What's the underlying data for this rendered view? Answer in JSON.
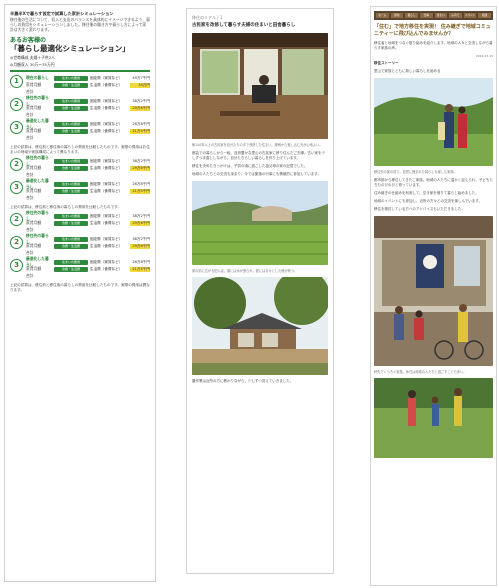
{
  "panel1": {
    "header": "半農半Xで暮らす仮定で試算した家計シミュレーション",
    "lead": "移住後の生活について、収入と支出のバランスを具体的にイメージできるよう、暮らしの費用をシミュレーションしました。移住後の働き方や暮らし方によって家計は大きく変わります。",
    "sim_title": "あるお客様の",
    "sim_title_big": "「暮らし最適化シミュレーション」",
    "meta1": "◎世帯構成 夫婦＋子供2人",
    "meta2": "◎月額収入 30万〜35万円",
    "steps": [
      {
        "num": "1",
        "head": "現在の暮らし",
        "b1": "住まいの費用",
        "b2": "食費・生活費",
        "sub1": "家賃月額",
        "sub2": "合計",
        "v1": "固定費（家賃など）",
        "v2": "生活費（食費など）",
        "a1": "49万7千円",
        "a2": "34万円"
      },
      {
        "num": "2",
        "head": "移住先の暮らし",
        "b1": "住まいの費用",
        "b2": "食費・生活費",
        "sub1": "家賃月額",
        "sub2": "合計",
        "v1": "固定費（家賃など）",
        "v2": "生活費（食費など）",
        "a1": "38万2千円",
        "a2": "29万6千円"
      },
      {
        "num": "3",
        "head": "最適化した暮らし",
        "b1": "住まいの費用",
        "b2": "食費・生活費",
        "sub1": "家賃月額",
        "sub2": "合計",
        "v1": "固定費（家賃など）",
        "v2": "生活費（食費など）",
        "a1": "26万8千円",
        "a2": "21万5千円"
      }
    ],
    "note": "上記の試算は、移住前と移住後の暮らしの費用を比較したものです。実際の費用はお住まいの地域や家族構成によって異なります。",
    "steps_b": [
      {
        "num": "2",
        "head": "移住先の暮らし",
        "b1": "住まいの費用",
        "b2": "食費・生活費",
        "sub1": "家賃月額",
        "sub2": "合計",
        "v1": "固定費（家賃など）",
        "v2": "生活費（食費など）",
        "a1": "38万2千円",
        "a2": "29万6千円"
      },
      {
        "num": "3",
        "head": "最適化した暮らし",
        "b1": "住まいの費用",
        "b2": "食費・生活費",
        "sub1": "家賃月額",
        "sub2": "合計",
        "v1": "固定費（家賃など）",
        "v2": "生活費（食費など）",
        "a1": "26万8千円",
        "a2": "21万5千円"
      }
    ],
    "note2": "上記の試算は、移住前と移住後の暮らしの費用を比較したものです。",
    "steps_c": [
      {
        "num": "2",
        "head": "移住先の暮らし",
        "b1": "住まいの費用",
        "b2": "食費・生活費",
        "sub1": "家賃月額",
        "sub2": "合計",
        "v1": "固定費（家賃など）",
        "v2": "生活費（食費など）",
        "a1": "38万2千円",
        "a2": "29万6千円"
      },
      {
        "num": "2",
        "head": "移住先の暮らし",
        "b1": "住まいの費用",
        "b2": "食費・生活費",
        "sub1": "家賃月額",
        "sub2": "合計",
        "v1": "固定費（家賃など）",
        "v2": "生活費（食費など）",
        "a1": "38万2千円",
        "a2": "29万6千円"
      },
      {
        "num": "3",
        "head": "最適化した暮らし",
        "b1": "住まいの費用",
        "b2": "食費・生活費",
        "sub1": "家賃月額",
        "sub2": "合計",
        "v1": "固定費（家賃など）",
        "v2": "生活費（食費など）",
        "a1": "26万8千円",
        "a2": "21万5千円"
      }
    ],
    "note3": "上記の試算は、移住前と移住後の暮らしの費用を比較したものです。実際の費用は異なります。"
  },
  "panel2": {
    "tag": "移住のリアル | 1",
    "title": "古民家を改修して暮らす夫婦の住まいと田舎暮らし",
    "cap1": "築100年以上の古民家を自分たちの手で改修した住まい。縁側から差し込む光が心地よい。",
    "t1": "都会での暮らしから一転、自然豊かな里山の古民家に移り住んだご夫婦。古い家を少しずつ手直ししながら、自分たちらしい暮らしを作り上げています。",
    "t2": "移住を決めたきっかけは、子供の頃に過ごした祖父母の家の記憶でした。",
    "t3": "地域の人たちとの交流も深まり、今では集落の行事にも積極的に参加しています。",
    "cap2": "家の前に広がる田んぼ。春には水が張られ、夏には青々とした稲が育つ。",
    "t4": "農作業は近所の方に教わりながら、少しずつ覚えていきました。"
  },
  "panel3": {
    "nav": [
      "ホーム",
      "移住",
      "暮らし",
      "仕事",
      "住まい",
      "子育て",
      "イベント",
      "相談"
    ],
    "title": "「住む」で地方移住を実現！ 住み継ぎで地域コミュニティーに飛び込んでみませんか？",
    "lead": "移住者と地域をつなぐ取り組みを紹介します。地域の人々と交流しながら暮らす家族の声。",
    "date": "2024.03.15",
    "section": "移住ストーリー",
    "sub": "里山で家族とともに新しい暮らしを始める",
    "cap1": "移住先の家の前で。自然に囲まれた暮らしを楽しむ家族。",
    "t1": "都市部から移住してきたご家族。地域の人たちに温かく迎えられ、子どもたちものびのびと育っています。",
    "t2": "住み継ぎの仕組みを利用して、空き家を借りて暮らし始めました。",
    "t3": "地域のイベントにも参加し、近所の方々との交流を楽しんでいます。",
    "t4": "移住を検討している方へのアドバイスもいただきました。",
    "cap2": "軒先でくつろぐ家族。休日は地域の人たちと過ごすことも多い。"
  }
}
